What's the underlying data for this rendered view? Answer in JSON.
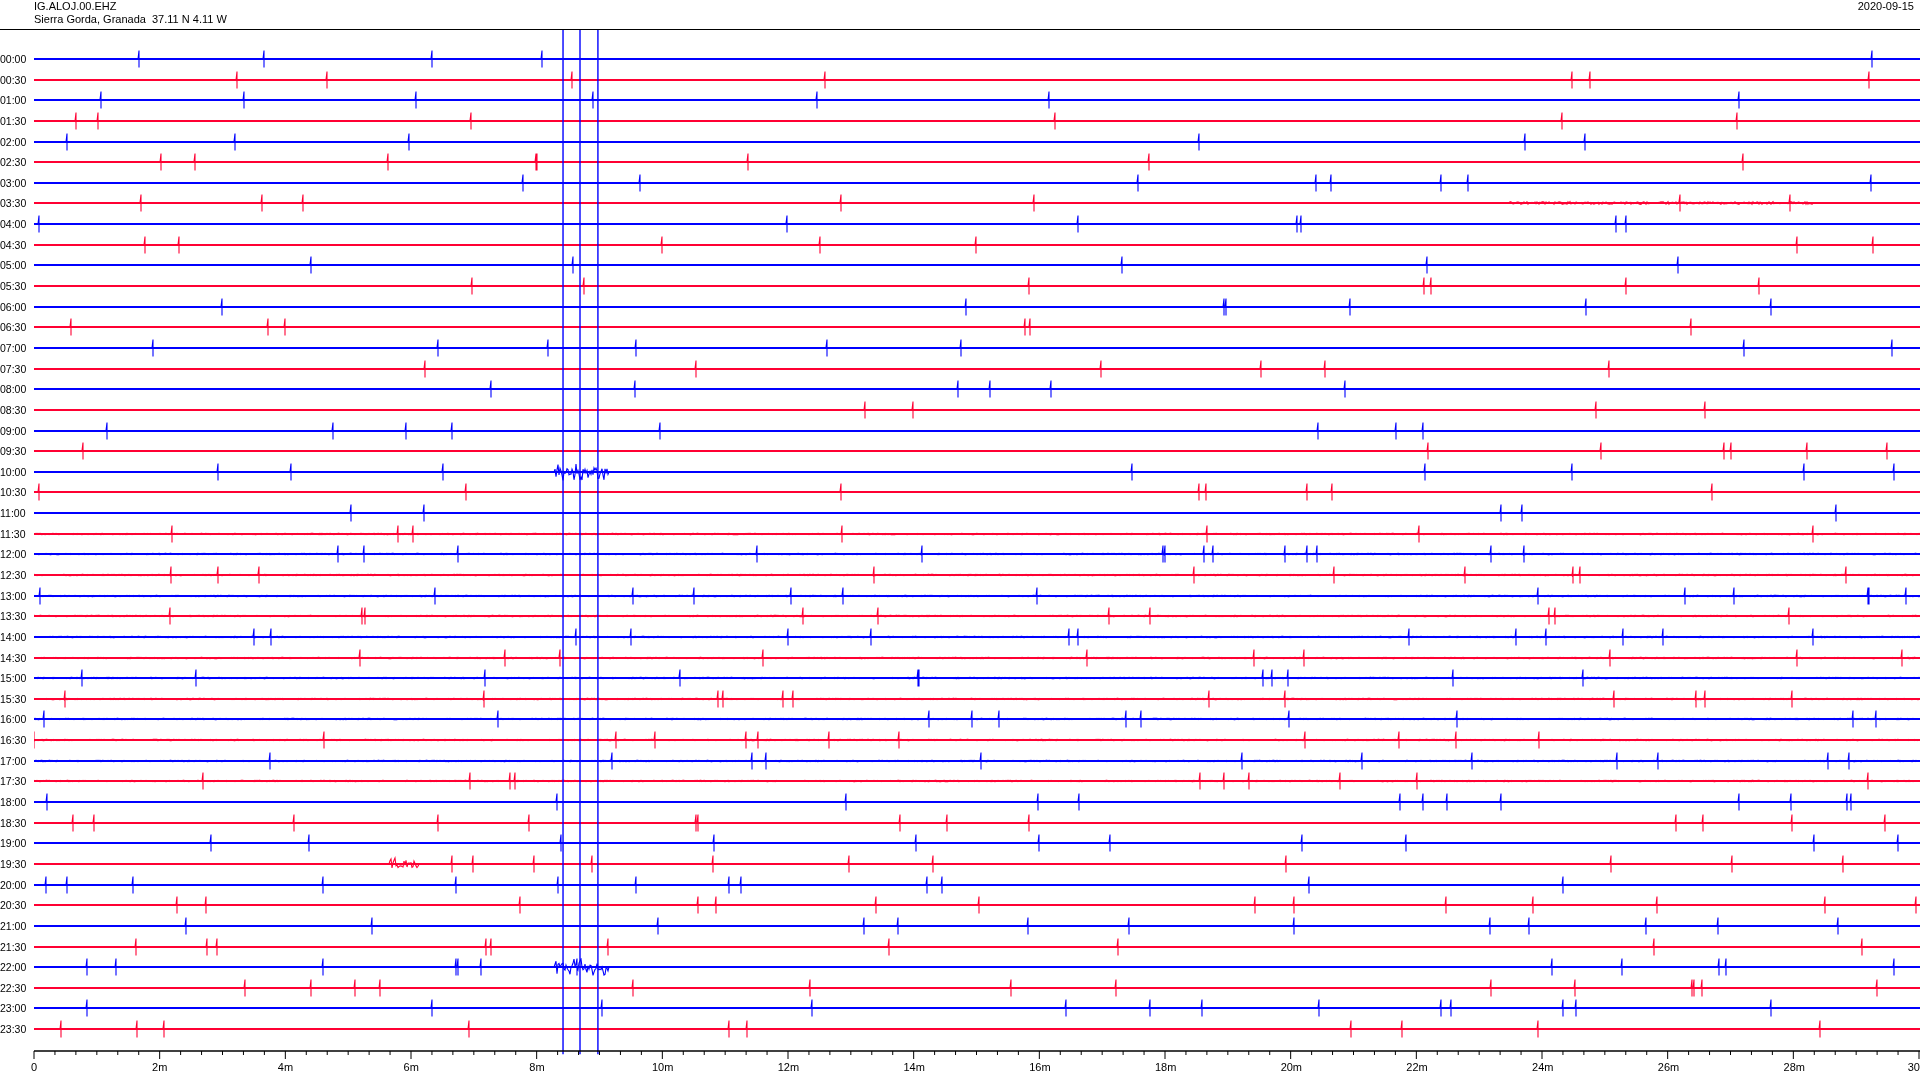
{
  "header": {
    "station": "IG.ALOJ.00.EHZ",
    "location": "Sierra Gorda, Granada  37.11 N 4.11 W",
    "date": "2020-09-15"
  },
  "rows": [
    {
      "label": "00:00",
      "color": "#0000ff"
    },
    {
      "label": "00:30",
      "color": "#ff0033"
    },
    {
      "label": "01:00",
      "color": "#0000ff"
    },
    {
      "label": "01:30",
      "color": "#ff0033"
    },
    {
      "label": "02:00",
      "color": "#0000ff"
    },
    {
      "label": "02:30",
      "color": "#ff0033"
    },
    {
      "label": "03:00",
      "color": "#0000ff"
    },
    {
      "label": "03:30",
      "color": "#ff0033"
    },
    {
      "label": "04:00",
      "color": "#0000ff"
    },
    {
      "label": "04:30",
      "color": "#ff0033"
    },
    {
      "label": "05:00",
      "color": "#0000ff"
    },
    {
      "label": "05:30",
      "color": "#ff0033"
    },
    {
      "label": "06:00",
      "color": "#0000ff"
    },
    {
      "label": "06:30",
      "color": "#ff0033"
    },
    {
      "label": "07:00",
      "color": "#0000ff"
    },
    {
      "label": "07:30",
      "color": "#ff0033"
    },
    {
      "label": "08:00",
      "color": "#0000ff"
    },
    {
      "label": "08:30",
      "color": "#ff0033"
    },
    {
      "label": "09:00",
      "color": "#0000ff"
    },
    {
      "label": "09:30",
      "color": "#ff0033"
    },
    {
      "label": "10:00",
      "color": "#0000ff"
    },
    {
      "label": "10:30",
      "color": "#ff0033"
    },
    {
      "label": "11:00",
      "color": "#0000ff"
    },
    {
      "label": "11:30",
      "color": "#ff0033"
    },
    {
      "label": "12:00",
      "color": "#0000ff"
    },
    {
      "label": "12:30",
      "color": "#ff0033"
    },
    {
      "label": "13:00",
      "color": "#0000ff"
    },
    {
      "label": "13:30",
      "color": "#ff0033"
    },
    {
      "label": "14:00",
      "color": "#0000ff"
    },
    {
      "label": "14:30",
      "color": "#ff0033"
    },
    {
      "label": "15:00",
      "color": "#0000ff"
    },
    {
      "label": "15:30",
      "color": "#ff0033"
    },
    {
      "label": "16:00",
      "color": "#0000ff"
    },
    {
      "label": "16:30",
      "color": "#ff0033"
    },
    {
      "label": "17:00",
      "color": "#0000ff"
    },
    {
      "label": "17:30",
      "color": "#ff0033"
    },
    {
      "label": "18:00",
      "color": "#0000ff"
    },
    {
      "label": "18:30",
      "color": "#ff0033"
    },
    {
      "label": "19:00",
      "color": "#0000ff"
    },
    {
      "label": "19:30",
      "color": "#ff0033"
    },
    {
      "label": "20:00",
      "color": "#0000ff"
    },
    {
      "label": "20:30",
      "color": "#ff0033"
    },
    {
      "label": "21:00",
      "color": "#0000ff"
    },
    {
      "label": "21:30",
      "color": "#ff0033"
    },
    {
      "label": "22:00",
      "color": "#0000ff"
    },
    {
      "label": "22:30",
      "color": "#ff0033"
    },
    {
      "label": "23:00",
      "color": "#0000ff"
    },
    {
      "label": "23:30",
      "color": "#ff0033"
    }
  ],
  "x_axis": {
    "ticks": [
      "0",
      "2m",
      "4m",
      "6m",
      "8m",
      "10m",
      "12m",
      "14m",
      "16m",
      "18m",
      "20m",
      "22m",
      "24m",
      "26m",
      "28m",
      "30"
    ]
  }
}
